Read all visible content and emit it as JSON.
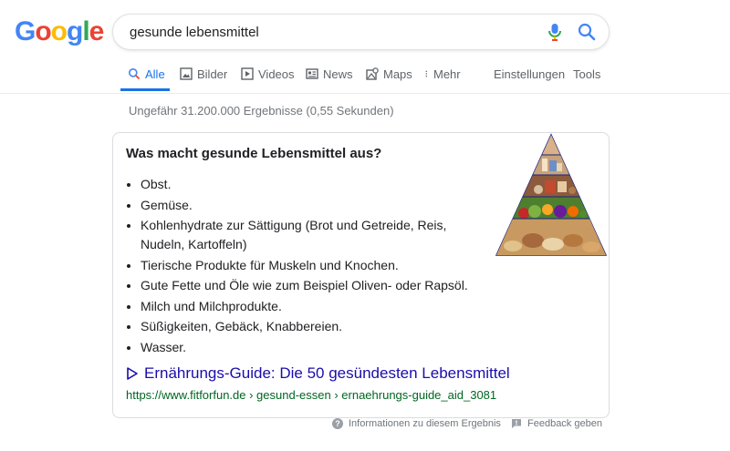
{
  "logo": {
    "letters": [
      "G",
      "o",
      "o",
      "g",
      "l",
      "e"
    ],
    "colors": [
      "#4285F4",
      "#EA4335",
      "#FBBC05",
      "#4285F4",
      "#34A853",
      "#EA4335"
    ]
  },
  "search": {
    "query": "gesunde lebensmittel"
  },
  "tabs": [
    {
      "label": "Alle",
      "icon": "search-icon"
    },
    {
      "label": "Bilder",
      "icon": "image-icon"
    },
    {
      "label": "Videos",
      "icon": "video-icon"
    },
    {
      "label": "News",
      "icon": "news-icon"
    },
    {
      "label": "Maps",
      "icon": "map-icon"
    },
    {
      "label": "Mehr",
      "icon": "more-vert-icon"
    }
  ],
  "tools": {
    "settings": "Einstellungen",
    "tools": "Tools"
  },
  "results_stats": "Ungefähr 31.200.000 Ergebnisse (0,55 Sekunden)",
  "snippet": {
    "heading": "Was macht gesunde Lebensmittel aus?",
    "items": [
      "Obst.",
      "Gemüse.",
      "Kohlenhydrate zur Sättigung (Brot und Getreide, Reis, Nudeln, Kartoffeln)",
      "Tierische Produkte für Muskeln und Knochen.",
      "Gute Fette und Öle wie zum Beispiel Oliven- oder Rapsöl.",
      "Milch und Milchprodukte.",
      "Süßigkeiten, Gebäck, Knabbereien.",
      "Wasser."
    ],
    "link_title": "Ernährungs-Guide: Die 50 gesündesten Lebensmittel",
    "url": "https://www.fitforfun.de › gesund-essen › ernaehrungs-guide_aid_3081"
  },
  "footer": {
    "info": "Informationen zu diesem Ergebnis",
    "feedback": "Feedback geben"
  },
  "colors": {
    "accent": "#1a73e8",
    "link": "#1a0dab",
    "url_green": "#006621"
  }
}
